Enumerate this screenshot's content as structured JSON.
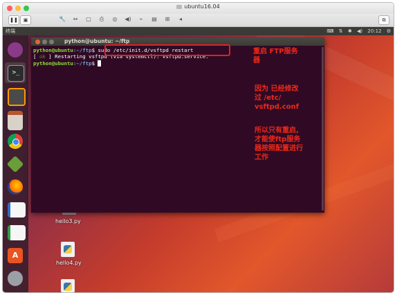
{
  "vm": {
    "title": "ubuntu16.04",
    "toolbar_icons": [
      "pause-icon",
      "snapshot-icon",
      "wrench-icon",
      "back-forward-icon",
      "disk-icon",
      "printer-icon",
      "camera-icon",
      "speaker-icon",
      "usb-icon",
      "floppy-icon",
      "network-icon",
      "more-icon",
      "window-icon"
    ],
    "toolbar_glyphs": {
      "pause": "❚❚",
      "snapshot": "▣",
      "wrench": "🔧",
      "arrows": "↔",
      "disk": "▢",
      "printer": "⎙",
      "camera": "◎",
      "speaker": "◀)",
      "usb": "⌁",
      "floppy": "▤",
      "network": "⊞",
      "more": "◂",
      "window": "⧉"
    }
  },
  "ubuntu": {
    "panel_title": "终端",
    "tray": {
      "keyboard": "⌨",
      "arrows": "⇅",
      "bluetooth": "✱",
      "volume": "◀)",
      "time": "20:12",
      "gear": "⚙"
    },
    "launcher_items": [
      "dash-home",
      "terminal",
      "sublime-text",
      "file-manager",
      "chrome",
      "mint-app",
      "firefox",
      "libreoffice-writer",
      "libreoffice-calc",
      "software-center",
      "system-settings"
    ],
    "desktop_icons": [
      {
        "label": "hello3.py"
      },
      {
        "label": "hello4.py"
      }
    ]
  },
  "terminal": {
    "title": "python@ubuntu: ~/ftp",
    "lines": [
      {
        "prompt": "python@ubuntu",
        "path": ":~/ftp",
        "command": "$ sudo /etc/init.d/vsftpd restart"
      },
      {
        "ok_open": "[ ",
        "ok": "ok",
        "ok_close": " ]",
        "text": " Restarting vsftpd (via systemctl): vsftpd.service."
      },
      {
        "prompt": "python@ubuntu",
        "path": ":~/ftp",
        "command": "$ "
      }
    ]
  },
  "annotations": {
    "note1": [
      "重启 FTP服务",
      "器"
    ],
    "note2": [
      "因为 已经修改",
      "过 /etc/",
      "vsftpd.conf"
    ],
    "note3": [
      "所以只有重启,",
      "才能使ftp服务",
      "器按照配置进行",
      "工作"
    ]
  }
}
